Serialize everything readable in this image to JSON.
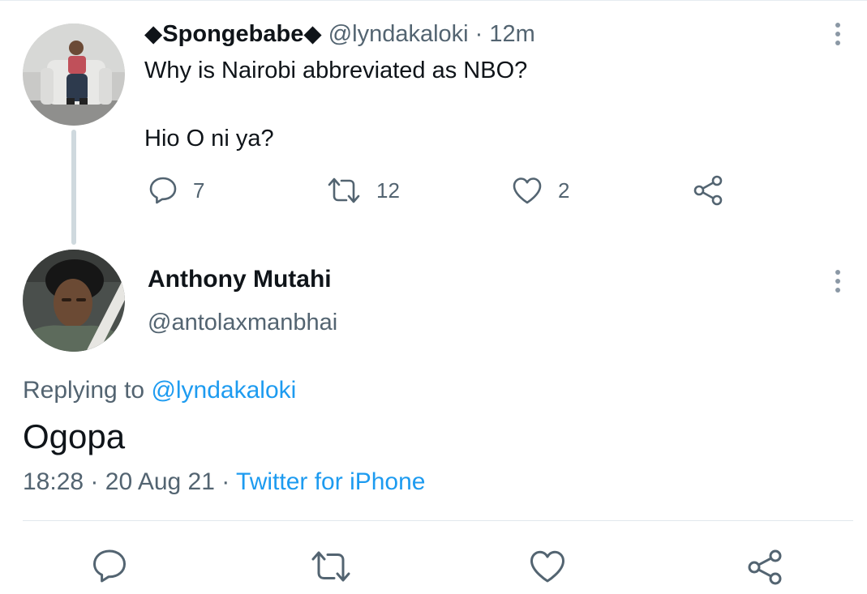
{
  "parent_tweet": {
    "display_name": "◆Spongebabe◆",
    "handle": "@lyndakaloki",
    "separator": "·",
    "time": "12m",
    "body_line1": "Why is Nairobi abbreviated as NBO?",
    "body_line2": "Hio O ni ya?",
    "reply_count": "7",
    "retweet_count": "12",
    "like_count": "2"
  },
  "main_tweet": {
    "display_name": "Anthony Mutahi",
    "handle": "@antolaxmanbhai",
    "replying_prefix": "Replying to",
    "replying_handle": "@lyndakaloki",
    "text": "Ogopa",
    "time": "18:28",
    "separator1": "·",
    "date": "20 Aug 21",
    "separator2": "·",
    "source": "Twitter for iPhone"
  },
  "colors": {
    "text_primary": "#0f1419",
    "text_secondary": "#536471",
    "link": "#1d9bf0",
    "divider": "#e1e8ed",
    "thread_line": "#cfd9de"
  },
  "icons": {
    "reply": "reply-icon",
    "retweet": "retweet-icon",
    "like": "heart-icon",
    "share": "share-icon",
    "more": "more-vertical-icon"
  }
}
